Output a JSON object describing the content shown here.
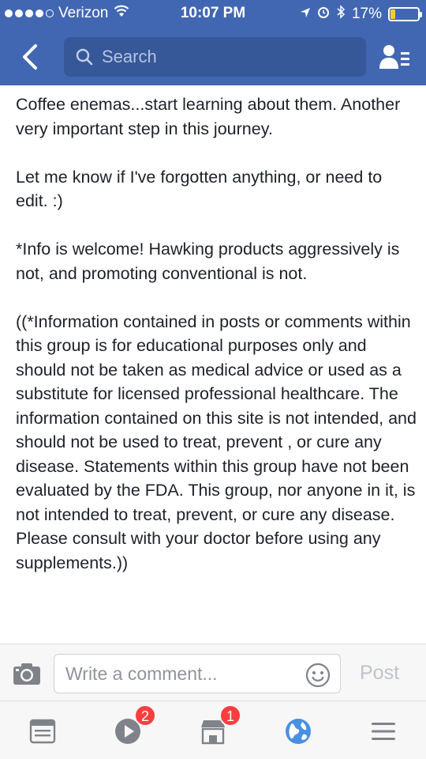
{
  "status_bar": {
    "carrier": "Verizon",
    "time": "10:07 PM",
    "battery": "17%",
    "battery_level": 0.17,
    "signal_bars": 4,
    "icons": [
      "wifi-icon",
      "location-arrow-icon",
      "alarm-icon",
      "bluetooth-icon",
      "battery-icon"
    ]
  },
  "nav": {
    "search_placeholder": "Search",
    "icons": [
      "back-chevron-icon",
      "search-icon",
      "friends-list-icon"
    ]
  },
  "content": {
    "paragraphs": [
      "Coffee enemas...start learning about them. Another very important step in this journey.",
      "Let me know if I've forgotten anything, or need to edit.  :)",
      "*Info is welcome!  Hawking products aggressively is not, and promoting conventional is not.",
      "((*Information contained in posts or comments within this group is for educational purposes only and should not be taken as medical advice or used as a substitute for licensed professional healthcare. The information contained on this site is not intended, and should not be used to treat, prevent , or cure any disease. Statements within this group have not been evaluated by the FDA. This group, nor anyone in it, is not intended to treat, prevent, or cure any disease. Please consult with your doctor before using any supplements.))"
    ]
  },
  "comment_bar": {
    "placeholder": "Write a comment...",
    "post_label": "Post",
    "icons": [
      "camera-icon",
      "emoji-icon"
    ]
  },
  "tab_bar": {
    "tabs": [
      {
        "name": "news-feed",
        "icon": "news-feed-icon",
        "badge": ""
      },
      {
        "name": "video",
        "icon": "video-play-icon",
        "badge": "2"
      },
      {
        "name": "marketplace",
        "icon": "marketplace-store-icon",
        "badge": "1"
      },
      {
        "name": "notifications",
        "icon": "globe-icon",
        "badge": ""
      },
      {
        "name": "menu",
        "icon": "hamburger-menu-icon",
        "badge": ""
      }
    ]
  },
  "colors": {
    "header_bg": "#4267b2",
    "search_bg": "#365899",
    "badge": "#fa3e3e",
    "globe_active": "#4a90e2",
    "text": "#1d2129",
    "muted": "#90949c"
  }
}
